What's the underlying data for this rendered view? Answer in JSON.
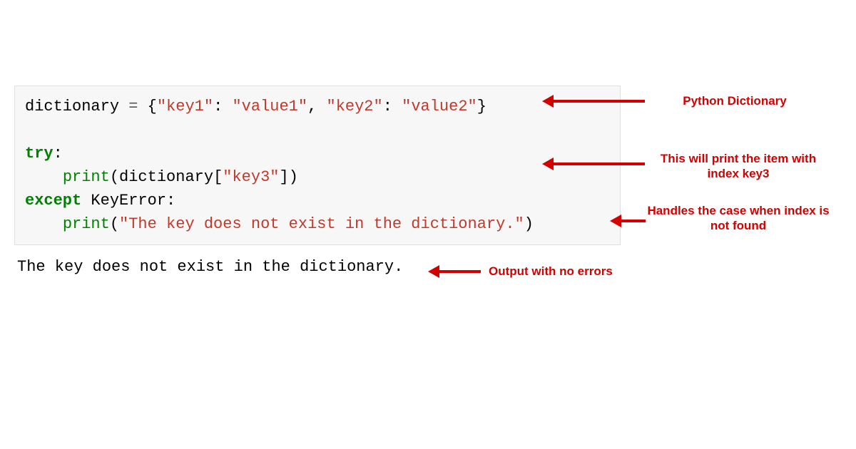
{
  "code": {
    "l1_var": "dictionary",
    "l1_assign": " = ",
    "l1_open": "{",
    "l1_k1": "\"key1\"",
    "l1_c1": ": ",
    "l1_v1": "\"value1\"",
    "l1_comma": ", ",
    "l1_k2": "\"key2\"",
    "l1_c2": ": ",
    "l1_v2": "\"value2\"",
    "l1_close": "}",
    "l2_blank": "",
    "l3_try": "try",
    "l3_colon": ":",
    "l4_indent": "    ",
    "l4_print": "print",
    "l4_open": "(",
    "l4_dict": "dictionary",
    "l4_br_open": "[",
    "l4_k3": "\"key3\"",
    "l4_br_close": "]",
    "l4_close": ")",
    "l5_except": "except",
    "l5_sp": " ",
    "l5_exc": "KeyError",
    "l5_colon": ":",
    "l6_indent": "    ",
    "l6_print": "print",
    "l6_open": "(",
    "l6_msg": "\"The key does not exist in the dictionary.\"",
    "l6_close": ")"
  },
  "output": "The key does not exist in the dictionary.",
  "annotations": {
    "a1": "Python Dictionary",
    "a2": "This will print the item with index key3",
    "a3": "Handles the case when index is not found",
    "a4": "Output with no errors"
  }
}
